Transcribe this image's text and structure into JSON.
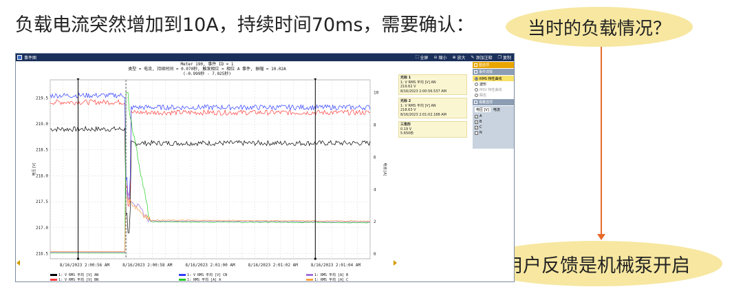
{
  "headline": "负载电流突然增加到10A，持续时间70ms，需要确认：",
  "bubble_top": "当时的负载情况？",
  "bubble_bottom": "用户反馈是机械泵开启",
  "colors": {
    "bubble": "#f7e7a0",
    "arrow": "#e86a2a",
    "titlebar": "#1a2f5a",
    "panel_orange": "#e8a400"
  },
  "app": {
    "title": "事件图",
    "tools": [
      {
        "icon": "fullscreen-icon",
        "label": "全屏"
      },
      {
        "icon": "zoom-out-icon",
        "label": "缩小"
      },
      {
        "icon": "zoom-in-icon",
        "label": "放大"
      },
      {
        "icon": "add-note-icon",
        "label": "添加注释"
      },
      {
        "icon": "copy-icon",
        "label": "复制"
      }
    ],
    "chart_header": [
      "Meter 190, 事件 ID = 1",
      "类型 = 电流, 持续时间 = 0.070秒, 触发相位 = 相位 A 事件, 振幅 = 10.02A",
      "(-0.999秒 - 7.025秒)"
    ],
    "markers": [
      {
        "title": "光标 1",
        "channel": "1: V RMS 平均 [V] AN",
        "value": "219.62 V",
        "time": "8/16/2023 2:00:56.537 AM"
      },
      {
        "title": "光标 2",
        "channel": "1: V RMS 平均 [V] AN",
        "value": "218.63 V",
        "time": "8/16/2023 2:01:02.188 AM"
      },
      {
        "title": "三角形",
        "value": "0.19 V",
        "time": "5.650秒"
      }
    ],
    "side_panel": {
      "chart_options": "图选项",
      "event_details": "事件详情",
      "radio_options": [
        {
          "label": "RMS 特性曲线",
          "selected": true
        },
        {
          "label": "波形",
          "selected": false
        },
        {
          "label": "MSV 特性曲线",
          "selected": false,
          "disabled": true
        },
        {
          "label": "瞬态",
          "selected": false,
          "disabled": true
        }
      ],
      "channel_options": "相量选项",
      "tabs": [
        "电压 [V]",
        "电流"
      ],
      "channels": [
        {
          "label": "A",
          "checked": true
        },
        {
          "label": "B",
          "checked": true
        },
        {
          "label": "C",
          "checked": true
        },
        {
          "label": "N",
          "checked": false
        }
      ]
    },
    "legend": [
      {
        "label": "1: V RMS 平均 [V] AN",
        "color": "#000000"
      },
      {
        "label": "1: V RMS 平均 [V] BN",
        "color": "#ff3b3b"
      },
      {
        "label": "1: V RMS 平均 [V] CN",
        "color": "#2f3cff"
      },
      {
        "label": "1: RMS 平均 [A] A",
        "color": "#22cc22"
      },
      {
        "label": "1: RMS 平均 [A] B",
        "color": "#a070e0"
      },
      {
        "label": "1: RMS 平均 [A] C",
        "color": "#ffa040"
      }
    ]
  },
  "chart_data": {
    "type": "line",
    "xlabel": "",
    "x_ticks": [
      "8/16/2023 2:00:56 AM",
      "8/16/2023 2:00:58 AM",
      "8/16/2023 2:01:00 AM",
      "8/16/2023 2:01:02 AM",
      "8/16/2023 2:01:04 AM"
    ],
    "y_left": {
      "label": "电压 [V]",
      "ticks": [
        "219.5",
        "219.0",
        "218.5",
        "218.0",
        "217.5",
        "217.0",
        "216.5"
      ],
      "ylim": [
        216.4,
        219.85
      ]
    },
    "y_right": {
      "label": "电流 [A]",
      "ticks": [
        "10",
        "8",
        "6",
        "4",
        "2",
        "0"
      ],
      "ylim": [
        -0.3,
        10.8
      ]
    },
    "xlim": [
      -0.999,
      7.025
    ],
    "event_time": 0.9,
    "cursors": [
      -0.3,
      5.65
    ],
    "series": [
      {
        "name": "1: V RMS 平均 [V] AN",
        "axis": "left",
        "before": 218.9,
        "after": 218.63,
        "noise": 0.05
      },
      {
        "name": "1: V RMS 平均 [V] BN",
        "axis": "left",
        "before": 219.42,
        "after": 219.22,
        "noise": 0.05
      },
      {
        "name": "1: V RMS 平均 [V] CN",
        "axis": "left",
        "before": 219.55,
        "after": 219.32,
        "noise": 0.05
      },
      {
        "name": "1: RMS 平均 [A] A",
        "axis": "right",
        "before": 0.05,
        "after": 2.0,
        "peak": 10.02
      },
      {
        "name": "1: RMS 平均 [A] B",
        "axis": "right",
        "before": 0.1,
        "after": 2.05,
        "peak": 3.8
      },
      {
        "name": "1: RMS 平均 [A] C",
        "axis": "right",
        "before": 0.15,
        "after": 2.1,
        "peak": 3.5
      }
    ]
  }
}
